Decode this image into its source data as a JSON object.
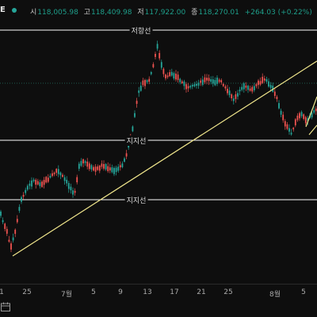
{
  "header": {
    "symbol_partial": "E",
    "ohlc": [
      {
        "label": "시",
        "value": "118,005.98"
      },
      {
        "label": "고",
        "value": "118,409.98"
      },
      {
        "label": "저",
        "value": "117,922.00"
      },
      {
        "label": "종",
        "value": "118,270.01"
      }
    ],
    "change": "+264.03 (+0.22%)"
  },
  "levels": [
    {
      "label": "저항선"
    },
    {
      "label": "지지선"
    },
    {
      "label": "지지선"
    }
  ],
  "xaxis": {
    "ticks": [
      "1",
      "25",
      "7월",
      "5",
      "9",
      "13",
      "17",
      "21",
      "25",
      "8월",
      "5"
    ]
  },
  "colors": {
    "up": "#26a69a",
    "down": "#ef5350",
    "level_line": "#ffffff",
    "trend_line": "#f0e68c",
    "accent_dot": "#26a69a"
  }
}
